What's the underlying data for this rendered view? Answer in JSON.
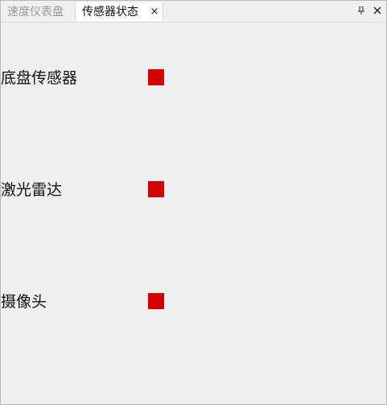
{
  "tabs": [
    {
      "label": "速度仪表盘",
      "active": false
    },
    {
      "label": "传感器状态",
      "active": true
    }
  ],
  "tab_close_glyph": "×",
  "window_buttons": {
    "pin_icon": "pin-icon",
    "close_icon": "close-icon"
  },
  "sensors": [
    {
      "label": "底盘传感器",
      "status_color": "#d60000"
    },
    {
      "label": "激光雷达",
      "status_color": "#d60000"
    },
    {
      "label": "摄像头",
      "status_color": "#d60000"
    }
  ],
  "colors": {
    "panel_background": "#efefef",
    "tab_active_background": "#ffffff",
    "tab_inactive_text": "#9a9a9a",
    "indicator_red": "#d60000"
  }
}
